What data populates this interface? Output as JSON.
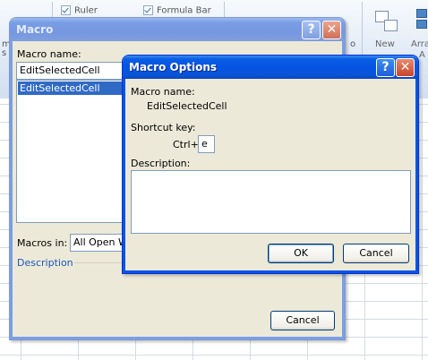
{
  "ribbon": {
    "ruler_label": "Ruler",
    "formula_bar_label": "Formula Bar",
    "new_label": "New",
    "arrange_label": "Arra",
    "left_fragment_top": "m",
    "left_fragment_bottom": "s",
    "fragment_o": "o",
    "fragment_a": "A"
  },
  "macro_dialog": {
    "title": "Macro",
    "help_glyph": "?",
    "close_glyph": "✕",
    "macro_name_label": "Macro name:",
    "macro_name_value": "EditSelectedCell",
    "list_items": [
      "EditSelectedCell"
    ],
    "macros_in_label": "Macros in:",
    "macros_in_value": "All Open Wo",
    "description_label": "Description",
    "cancel_label": "Cancel"
  },
  "options_dialog": {
    "title": "Macro Options",
    "help_glyph": "?",
    "close_glyph": "✕",
    "macro_name_label": "Macro name:",
    "macro_name_value": "EditSelectedCell",
    "shortcut_label": "Shortcut key:",
    "ctrl_label": "Ctrl+",
    "shortcut_value": "e",
    "description_label": "Description:",
    "description_value": "",
    "ok_label": "OK",
    "cancel_label": "Cancel"
  },
  "colors": {
    "titlebar_active": "#0554e3",
    "titlebar_inactive": "#7a9ee6",
    "dialog_face": "#ece9d8",
    "selection": "#316ac5",
    "link_blue": "#1f55b8"
  }
}
